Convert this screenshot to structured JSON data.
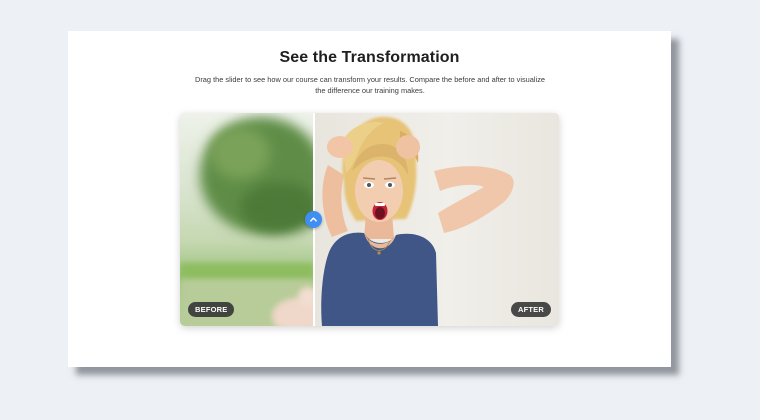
{
  "section": {
    "title": "See the Transformation",
    "description": "Drag the slider to see how our course can transform your results. Compare the before and after to visualize the difference our training makes."
  },
  "slider": {
    "position_percent": 35.4,
    "before_label": "BEFORE",
    "after_label": "AFTER",
    "handle_icon": "chevron-up-icon",
    "handle_color": "#3f8ef2"
  }
}
